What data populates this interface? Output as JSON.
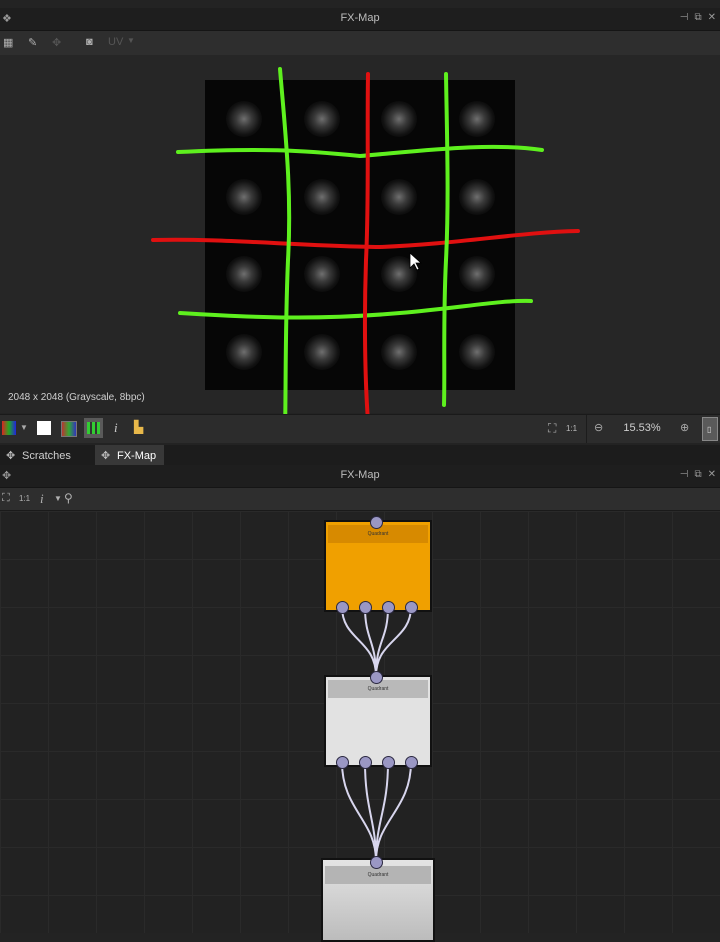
{
  "top_panel": {
    "title": "FX-Map",
    "toolbar_uv_label": "UV",
    "image_info": "2048 x 2048 (Grayscale, 8bpc)",
    "zoom": "15.53%",
    "ratio_label": "1:1",
    "info_icon_label": "i"
  },
  "tabs": [
    {
      "label": "Scratches",
      "active": false
    },
    {
      "label": "FX-Map",
      "active": true
    }
  ],
  "bottom_panel": {
    "title": "FX-Map",
    "ratio_label": "1:1",
    "info_icon_label": "i"
  },
  "nodes": [
    {
      "label": "Quadrant",
      "color": "#f0a000",
      "head_color": "#d78a00"
    },
    {
      "label": "Quadrant",
      "color": "#e2e2e2",
      "head_color": "#b9b9b9"
    },
    {
      "label": "Quadrant",
      "color": "#dcdcdc",
      "head_color": "#b4b4b4"
    }
  ],
  "annotation_colors": {
    "green": "#5ef01e",
    "red": "#e01010"
  },
  "port_color": "#9a97c4"
}
